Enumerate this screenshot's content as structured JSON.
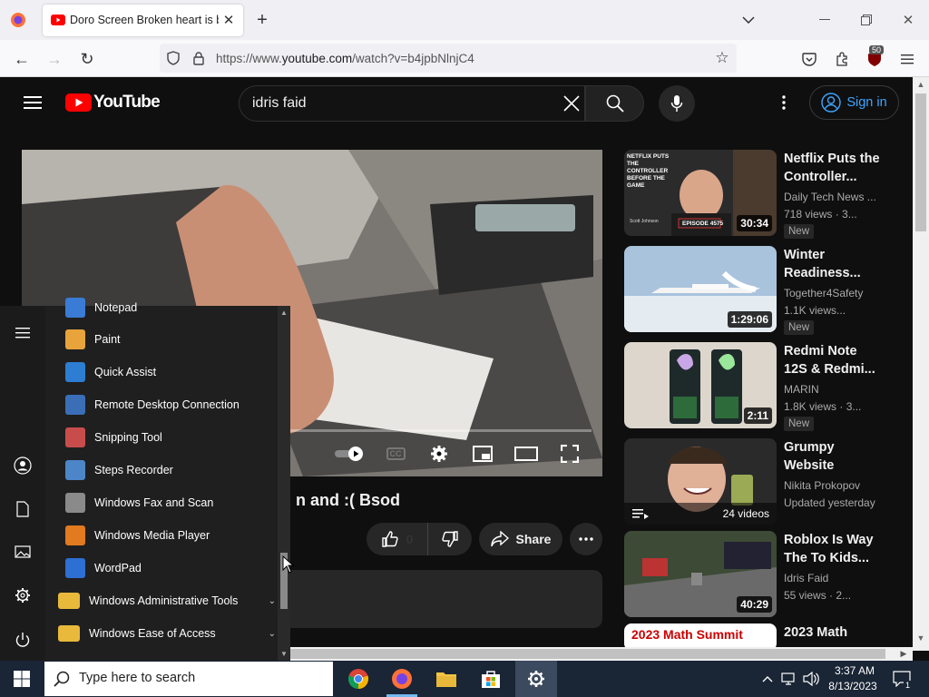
{
  "browser": {
    "tab_title": "Doro Screen Broken heart is broken and :( Bsod",
    "new_tab": "+",
    "url_prefix": "https://www.",
    "url_domain": "youtube.com",
    "url_path": "/watch?v=b4jpbNlnjC4",
    "extensions_badge": "50"
  },
  "youtube": {
    "logo_text": "YouTube",
    "search_value": "idris faid",
    "signin_label": "Sign in",
    "video_title_visible": "n and :( Bsod",
    "like_count": "0",
    "share_label": "Share",
    "cc_label": "CC",
    "recommendations": [
      {
        "title": "Netflix Puts the Controller...",
        "channel": "Daily Tech News ...",
        "meta": "718 views · 3...",
        "badge": "New",
        "duration": "30:34",
        "thumb_caption": "NETFLIX PUTS THE CONTROLLER BEFORE THE GAME",
        "thumb_tag": "EPISODE 4575",
        "thumb_name": "Scott Johnson"
      },
      {
        "title": "Winter Readiness...",
        "channel": "Together4Safety",
        "meta": "1.1K views...",
        "badge": "New",
        "duration": "1:29:06"
      },
      {
        "title": "Redmi Note 12S & Redmi...",
        "channel": "MARIN",
        "meta": "1.8K views · 3...",
        "badge": "New",
        "duration": "2:11"
      },
      {
        "title": "Grumpy Website",
        "channel": "Nikita Prokopov",
        "meta": "Updated yesterday",
        "badge": "",
        "duration": "24 videos"
      },
      {
        "title": "Roblox Is Way The To Kids...",
        "channel": "Idris Faid",
        "meta": "55 views · 2...",
        "badge": "",
        "duration": "40:29"
      },
      {
        "title": "2023 Math",
        "channel": "",
        "meta": "",
        "badge": "",
        "duration": "",
        "thumb_caption": "2023 Math Summit"
      }
    ]
  },
  "start_menu": {
    "apps": [
      {
        "label": "Notepad",
        "color": "#3a7bd5"
      },
      {
        "label": "Paint",
        "color": "#e8a33b"
      },
      {
        "label": "Quick Assist",
        "color": "#2d7dd2"
      },
      {
        "label": "Remote Desktop Connection",
        "color": "#3a6fb8"
      },
      {
        "label": "Snipping Tool",
        "color": "#c94c4c"
      },
      {
        "label": "Steps Recorder",
        "color": "#4c86c9"
      },
      {
        "label": "Windows Fax and Scan",
        "color": "#8a8a8a"
      },
      {
        "label": "Windows Media Player",
        "color": "#e27a1f"
      },
      {
        "label": "WordPad",
        "color": "#2d6fd2"
      }
    ],
    "folders": [
      {
        "label": "Windows Administrative Tools"
      },
      {
        "label": "Windows Ease of Access"
      }
    ]
  },
  "taskbar": {
    "search_placeholder": "Type here to search",
    "time": "3:37 AM",
    "date": "8/13/2023",
    "notification_count": "1"
  }
}
